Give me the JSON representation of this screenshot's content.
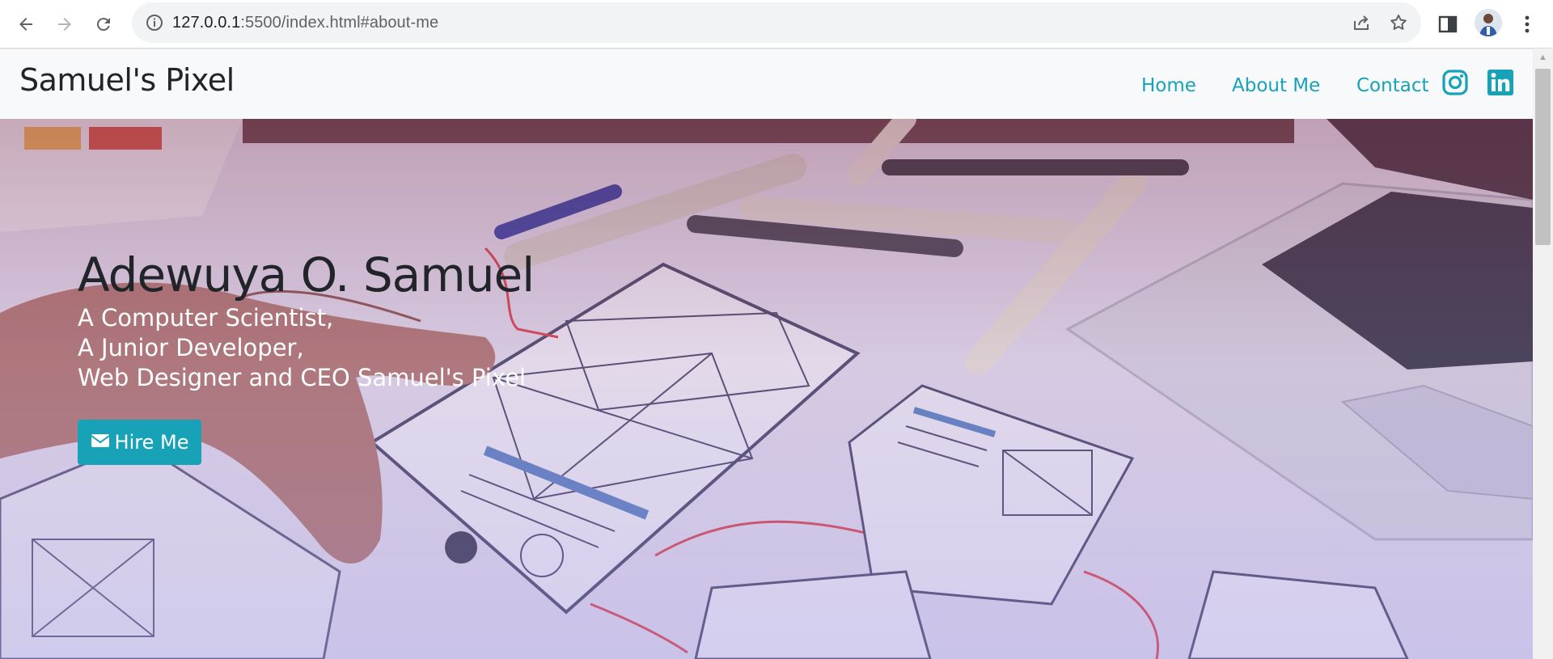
{
  "browser": {
    "url_host": "127.0.0.1",
    "url_rest": ":5500/index.html#about-me"
  },
  "site": {
    "brand": "Samuel's Pixel",
    "nav": [
      "Home",
      "About Me",
      "Contact"
    ],
    "social": [
      "instagram-icon",
      "linkedin-icon"
    ]
  },
  "hero": {
    "name": "Adewuya O. Samuel",
    "lines": [
      "A Computer Scientist,",
      "A Junior Developer,",
      "Web Designer and CEO Samuel's Pixel"
    ],
    "button_label": "Hire Me",
    "button_icon": "envelope-icon"
  },
  "colors": {
    "accent": "#17a2b8",
    "navbar_bg": "#f8f9fa",
    "brand_text": "#212529"
  }
}
